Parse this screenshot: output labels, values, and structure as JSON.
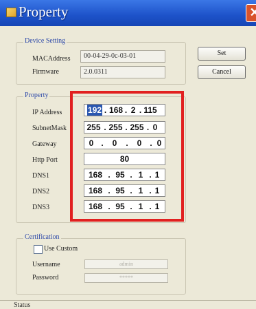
{
  "window": {
    "title": "Property",
    "close_glyph": "✕"
  },
  "device_setting": {
    "group_label": "Device Setting",
    "mac_label": "MACAddress",
    "mac_value": "00-04-29-0c-03-01",
    "firmware_label": "Firmware",
    "firmware_value": "2.0.0311"
  },
  "buttons": {
    "set": "Set",
    "cancel": "Cancel"
  },
  "property": {
    "group_label": "Property",
    "fields": [
      {
        "label": "IP Address",
        "octets": [
          "192",
          "168",
          "2",
          "115"
        ]
      },
      {
        "label": "SubnetMask",
        "octets": [
          "255",
          "255",
          "255",
          "0"
        ]
      },
      {
        "label": "Gateway",
        "octets": [
          "0",
          "0",
          "0",
          "0"
        ]
      },
      {
        "label": "Http Port",
        "value": "80"
      },
      {
        "label": "DNS1",
        "octets": [
          "168",
          "95",
          "1",
          "1"
        ]
      },
      {
        "label": "DNS2",
        "octets": [
          "168",
          "95",
          "1",
          "1"
        ]
      },
      {
        "label": "DNS3",
        "octets": [
          "168",
          "95",
          "1",
          "1"
        ]
      }
    ]
  },
  "certification": {
    "group_label": "Certification",
    "use_custom_label": "Use Custom",
    "username_label": "Username",
    "username_value": "admin",
    "password_label": "Password",
    "password_value": "*****"
  },
  "status": {
    "label": "Status"
  },
  "highlight": {
    "color": "#e12020"
  }
}
